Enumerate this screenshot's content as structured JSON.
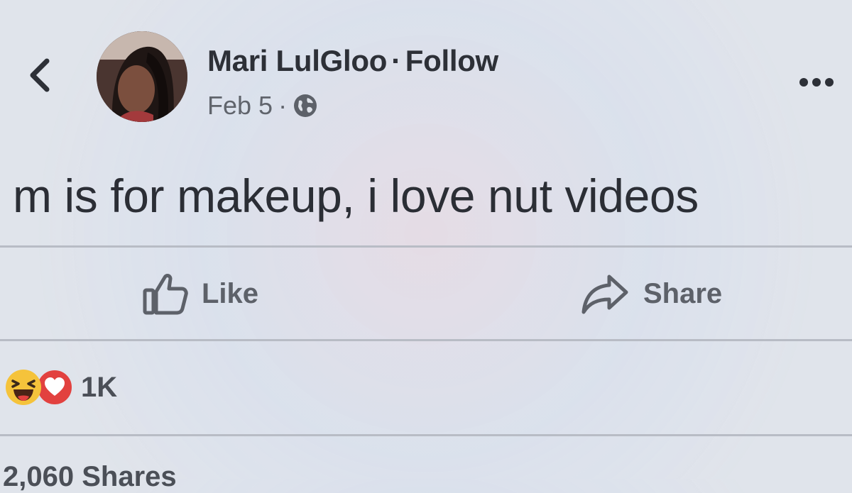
{
  "post": {
    "author_name": "Mari LulGloo",
    "separator": "·",
    "follow_label": "Follow",
    "date": "Feb 5",
    "meta_separator": "·",
    "privacy_icon": "globe-icon",
    "text": "m is for makeup, i love nut videos"
  },
  "nav": {
    "back_icon": "chevron-left-icon",
    "more_icon": "more-dots-icon"
  },
  "actions": {
    "like_label": "Like",
    "like_icon": "thumbs-up-icon",
    "share_label": "Share",
    "share_icon": "share-arrow-icon"
  },
  "reactions": {
    "types": [
      "haha",
      "love"
    ],
    "count": "1K"
  },
  "shares": {
    "label": "2,060 Shares"
  },
  "colors": {
    "text": "#2d3037",
    "muted": "#60646c",
    "haha": "#f5c33b",
    "love": "#e2413f"
  }
}
